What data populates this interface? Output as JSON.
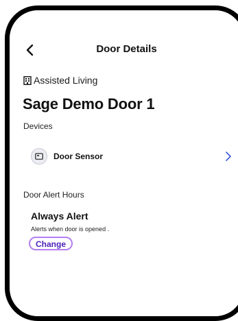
{
  "header": {
    "title": "Door Details"
  },
  "location": {
    "name": "Assisted Living"
  },
  "door": {
    "name": "Sage Demo Door 1"
  },
  "devices": {
    "label": "Devices",
    "items": [
      {
        "name": "Door Sensor"
      }
    ]
  },
  "alert_hours": {
    "label": "Door Alert Hours",
    "mode": "Always Alert",
    "description": "Alerts when door is opened .",
    "change_label": "Change"
  },
  "colors": {
    "accent_border": "#b27ef0",
    "accent_text": "#4a1fb8",
    "chevron": "#3b5bdb",
    "frame": "#000000"
  }
}
